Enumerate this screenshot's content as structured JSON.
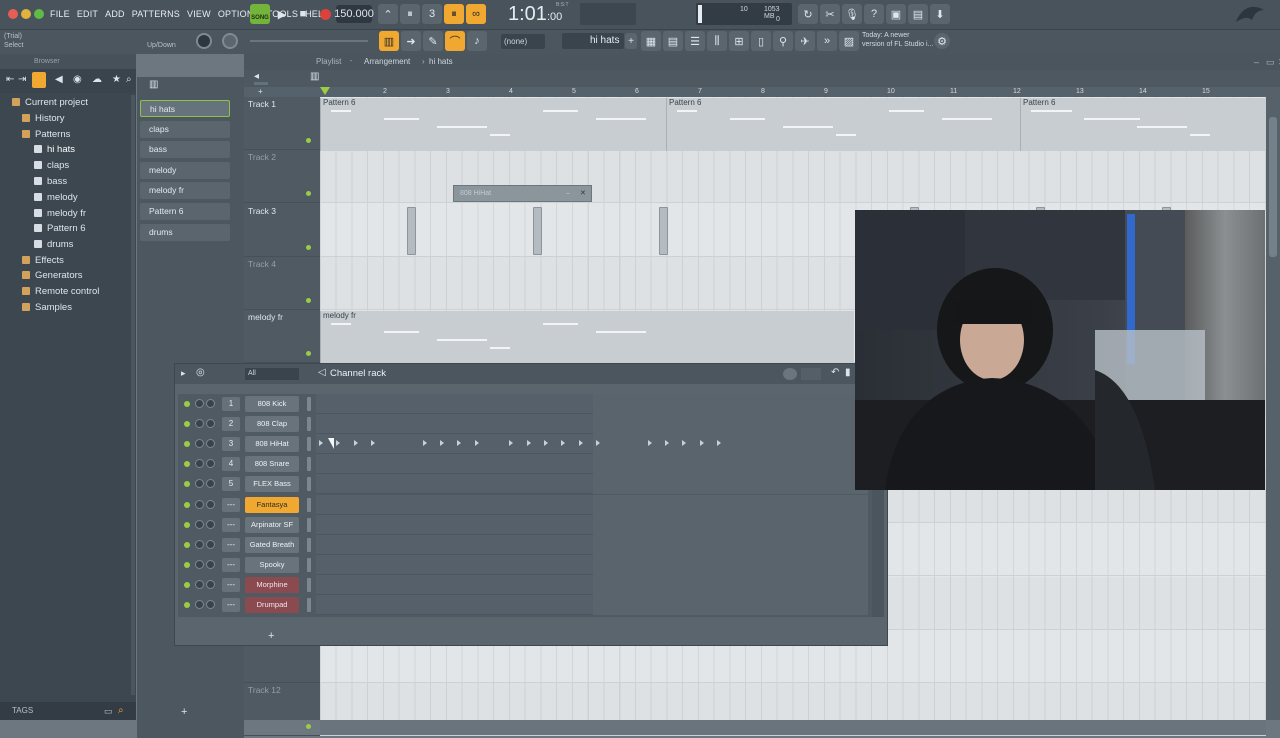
{
  "menu": [
    "FILE",
    "EDIT",
    "ADD",
    "PATTERNS",
    "VIEW",
    "OPTIONS",
    "TOOLS",
    "HELP"
  ],
  "transport": {
    "mode_label": "SONG",
    "tempo": "150.000",
    "time_main": "1:01",
    "time_sub": "00",
    "time_label": "B:S:T",
    "cpu_value": "10",
    "ram_value": "1053 MB",
    "poly_value": "0"
  },
  "hint": {
    "line1": "(Trial)",
    "line2": "Select",
    "updown": "Up/Down"
  },
  "pattern_selector": {
    "current": "hi hats",
    "none": "(none)"
  },
  "news": {
    "line1": "Today: A newer",
    "line2": "version of FL Studio i..."
  },
  "browser": {
    "title": "Browser",
    "items": [
      {
        "label": "Current project",
        "level": 0
      },
      {
        "label": "History",
        "level": 1
      },
      {
        "label": "Patterns",
        "level": 1
      },
      {
        "label": "hi hats",
        "level": 2,
        "selected": true
      },
      {
        "label": "claps",
        "level": 2
      },
      {
        "label": "bass",
        "level": 2
      },
      {
        "label": "melody",
        "level": 2
      },
      {
        "label": "melody fr",
        "level": 2
      },
      {
        "label": "Pattern 6",
        "level": 2
      },
      {
        "label": "drums",
        "level": 2
      },
      {
        "label": "Effects",
        "level": 1
      },
      {
        "label": "Generators",
        "level": 1
      },
      {
        "label": "Remote control",
        "level": 1
      },
      {
        "label": "Samples",
        "level": 1
      }
    ],
    "tags_label": "TAGS"
  },
  "patterns": [
    "hi hats",
    "claps",
    "bass",
    "melody",
    "melody fr",
    "Pattern 6",
    "drums"
  ],
  "playlist": {
    "title_prefix": "Playlist",
    "breadcrumb_1": "Arrangement",
    "breadcrumb_2": "hi hats",
    "ruler": [
      "2",
      "3",
      "4",
      "5",
      "6",
      "7",
      "8",
      "9",
      "10",
      "11",
      "12",
      "13",
      "14",
      "15"
    ],
    "tracks": [
      "Track 1",
      "Track 2",
      "Track 3",
      "Track 4",
      "melody fr",
      "Track 12"
    ],
    "clips": [
      {
        "label": "Pattern 6"
      },
      {
        "label": "Pattern 6"
      },
      {
        "label": "Pattern 6"
      },
      {
        "label": "melody fr"
      }
    ],
    "mini_window_label": "808 HiHat"
  },
  "channel_rack": {
    "title": "Channel rack",
    "filter": "All",
    "add_label": "+",
    "channels": [
      {
        "num": "1",
        "name": "808 Kick"
      },
      {
        "num": "2",
        "name": "808 Clap"
      },
      {
        "num": "3",
        "name": "808 HiHat"
      },
      {
        "num": "4",
        "name": "808 Snare"
      },
      {
        "num": "5",
        "name": "FLEX Bass"
      },
      {
        "num": "---",
        "name": "Fantasya",
        "color": "#f0a830"
      },
      {
        "num": "---",
        "name": "Arpinator SF"
      },
      {
        "num": "---",
        "name": "Gated Breath"
      },
      {
        "num": "---",
        "name": "Spooky"
      },
      {
        "num": "---",
        "name": "Morphine",
        "color": "#8a4a50"
      },
      {
        "num": "---",
        "name": "Drumpad",
        "color": "#8a4a50"
      }
    ],
    "hihat_steps": [
      1,
      2,
      3,
      4,
      7,
      8,
      9,
      10,
      12,
      13,
      14,
      15,
      16,
      17,
      20,
      21,
      22,
      23,
      24
    ]
  },
  "colors": {
    "accent_orange": "#f0a830",
    "led_green": "#9ccc43",
    "record_red": "#d9433b"
  }
}
